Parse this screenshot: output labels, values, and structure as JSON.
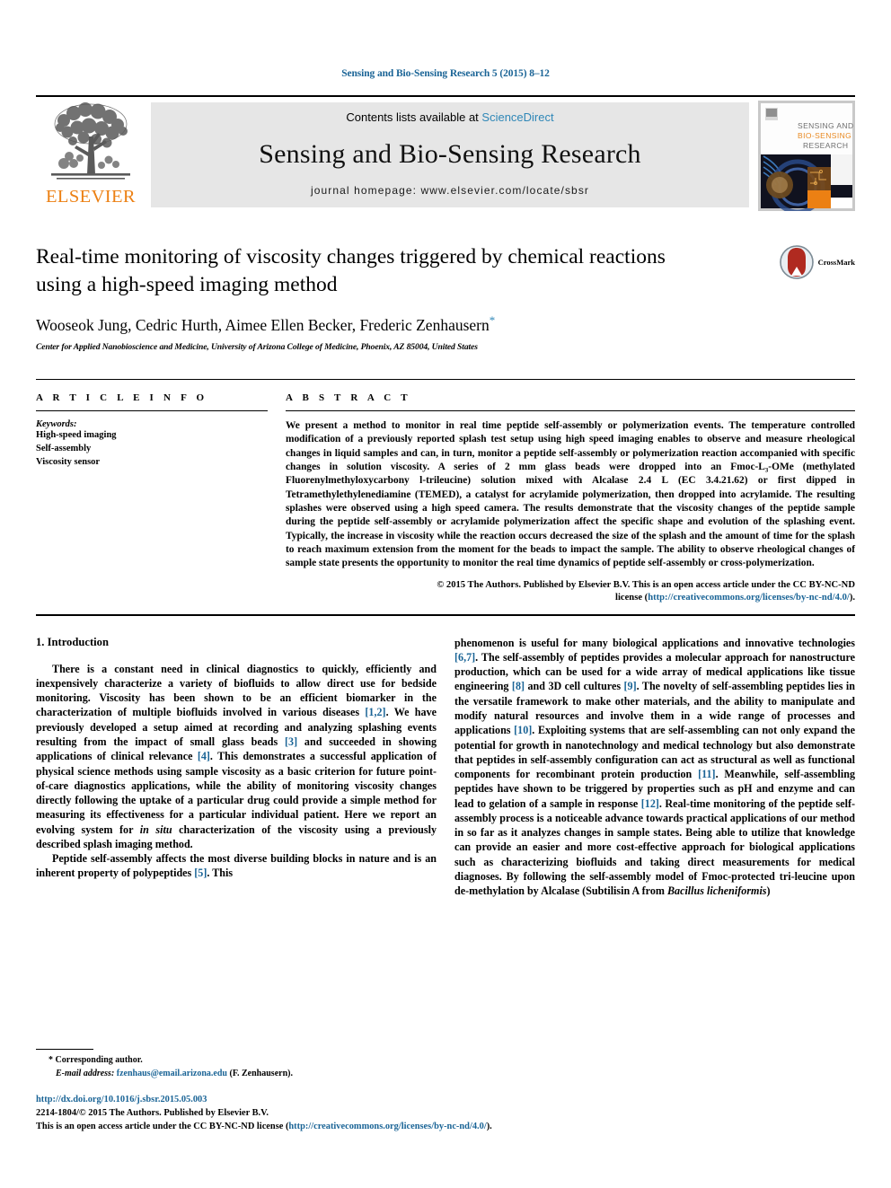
{
  "running_head": "Sensing and Bio-Sensing Research 5 (2015) 8–12",
  "masthead": {
    "publisher_name": "ELSEVIER",
    "contents_prefix": "Contents lists available at ",
    "contents_link": "ScienceDirect",
    "journal_title": "Sensing and Bio-Sensing Research",
    "homepage": "journal homepage: www.elsevier.com/locate/sbsr",
    "cover_line1": "SENSING AND",
    "cover_line2": "BIO-SENSING",
    "cover_line3": "RESEARCH"
  },
  "article": {
    "title": "Real-time monitoring of viscosity changes triggered by chemical reactions using a high-speed imaging method",
    "authors": "Wooseok Jung, Cedric Hurth, Aimee Ellen Becker, Frederic Zenhausern",
    "corresponding_marker": "*",
    "affiliation": "Center for Applied Nanobioscience and Medicine, University of Arizona College of Medicine, Phoenix, AZ 85004, United States",
    "crossmark_label": "CrossMark"
  },
  "info": {
    "heading": "A R T I C L E   I N F O",
    "keywords_label": "Keywords:",
    "keywords": [
      "High-speed imaging",
      "Self-assembly",
      "Viscosity sensor"
    ]
  },
  "abstract": {
    "heading": "A B S T R A C T",
    "text": "We present a method to monitor in real time peptide self-assembly or polymerization events. The temperature controlled modification of a previously reported splash test setup using high speed imaging enables to observe and measure rheological changes in liquid samples and can, in turn, monitor a peptide self-assembly or polymerization reaction accompanied with specific changes in solution viscosity. A series of 2 mm glass beads were dropped into an Fmoc-L₃-OMe (methylated Fluorenylmethyloxycarbony l-trileucine) solution mixed with Alcalase 2.4 L (EC 3.4.21.62) or first dipped in Tetramethylethylenediamine (TEMED), a catalyst for acrylamide polymerization, then dropped into acrylamide. The resulting splashes were observed using a high speed camera. The results demonstrate that the viscosity changes of the peptide sample during the peptide self-assembly or acrylamide polymerization affect the specific shape and evolution of the splashing event. Typically, the increase in viscosity while the reaction occurs decreased the size of the splash and the amount of time for the splash to reach maximum extension from the moment for the beads to impact the sample. The ability to observe rheological changes of sample state presents the opportunity to monitor the real time dynamics of peptide self-assembly or cross-polymerization.",
    "copyright_line": "© 2015 The Authors. Published by Elsevier B.V. This is an open access article under the CC BY-NC-ND",
    "license_prefix": "license (",
    "license_url": "http://creativecommons.org/licenses/by-nc-nd/4.0/",
    "license_suffix": ")."
  },
  "sections": {
    "intro_title": "1. Introduction",
    "left_paragraph_1_a": "There is a constant need in clinical diagnostics to quickly, efficiently and inexpensively characterize a variety of biofluids to allow direct use for bedside monitoring. Viscosity has been shown to be an efficient biomarker in the characterization of multiple biofluids involved in various diseases ",
    "ref_1_2": "[1,2]",
    "left_paragraph_1_b": ". We have previously developed a setup aimed at recording and analyzing splashing events resulting from the impact of small glass beads ",
    "ref_3": "[3]",
    "left_paragraph_1_c": " and succeeded in showing applications of clinical relevance ",
    "ref_4": "[4]",
    "left_paragraph_1_d": ". This demonstrates a successful application of physical science methods using sample viscosity as a basic criterion for future point-of-care diagnostics applications, while the ability of monitoring viscosity changes directly following the uptake of a particular drug could provide a simple method for measuring its effectiveness for a particular individual patient. Here we report an evolving system for ",
    "left_paragraph_1_e_italic": "in situ",
    "left_paragraph_1_f": " characterization of the viscosity using a previously described splash imaging method.",
    "left_paragraph_2_a": "Peptide self-assembly affects the most diverse building blocks in nature and is an inherent property of polypeptides ",
    "ref_5": "[5]",
    "left_paragraph_2_b": ". This",
    "right_paragraph_a": "phenomenon is useful for many biological applications and innovative technologies ",
    "ref_6_7": "[6,7]",
    "right_paragraph_b": ". The self-assembly of peptides provides a molecular approach for nanostructure production, which can be used for a wide array of medical applications like tissue engineering ",
    "ref_8": "[8]",
    "right_paragraph_c": " and 3D cell cultures ",
    "ref_9": "[9]",
    "right_paragraph_d": ". The novelty of self-assembling peptides lies in the versatile framework to make other materials, and the ability to manipulate and modify natural resources and involve them in a wide range of processes and applications ",
    "ref_10": "[10]",
    "right_paragraph_e": ". Exploiting systems that are self-assembling can not only expand the potential for growth in nanotechnology and medical technology but also demonstrate that peptides in self-assembly configuration can act as structural as well as functional components for recombinant protein production ",
    "ref_11": "[11]",
    "right_paragraph_f": ". Meanwhile, self-assembling peptides have shown to be triggered by properties such as pH and enzyme and can lead to gelation of a sample in response ",
    "ref_12": "[12]",
    "right_paragraph_g": ". Real-time monitoring of the peptide self-assembly process is a noticeable advance towards practical applications of our method in so far as it analyzes changes in sample states. Being able to utilize that knowledge can provide an easier and more cost-effective approach for biological applications such as characterizing biofluids and taking direct measurements for medical diagnoses. By following the self-assembly model of Fmoc-protected tri-leucine upon de-methylation by Alcalase (Subtilisin A from ",
    "right_paragraph_h_italic": "Bacillus licheniformis",
    "right_paragraph_i": ")"
  },
  "footnotes": {
    "corresponding_star": "*",
    "corresponding_text": "Corresponding author.",
    "email_label": "E-mail address:",
    "email": "fzenhaus@email.arizona.edu",
    "email_suffix": "(F. Zenhausern)."
  },
  "imprint": {
    "doi": "http://dx.doi.org/10.1016/j.sbsr.2015.05.003",
    "issn_line": "2214-1804/© 2015 The Authors. Published by Elsevier B.V.",
    "license_line_prefix": "This is an open access article under the CC BY-NC-ND license (",
    "license_line_url": "http://creativecommons.org/licenses/by-nc-nd/4.0/",
    "license_line_suffix": ")."
  },
  "colors": {
    "link": "#1a6496",
    "science_direct": "#2f87b7",
    "elsevier_orange": "#ec8013",
    "band_gray": "#e6e6e6"
  }
}
